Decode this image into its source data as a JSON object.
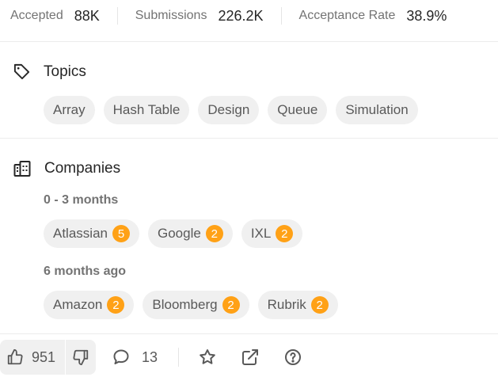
{
  "stats": [
    {
      "label": "Accepted",
      "value": "88K"
    },
    {
      "label": "Submissions",
      "value": "226.2K"
    },
    {
      "label": "Acceptance Rate",
      "value": "38.9%"
    }
  ],
  "topics": {
    "title": "Topics",
    "items": [
      "Array",
      "Hash Table",
      "Design",
      "Queue",
      "Simulation"
    ]
  },
  "companies": {
    "title": "Companies",
    "groups": [
      {
        "period": "0 - 3 months",
        "items": [
          {
            "name": "Atlassian",
            "count": "5"
          },
          {
            "name": "Google",
            "count": "2"
          },
          {
            "name": "IXL",
            "count": "2"
          }
        ]
      },
      {
        "period": "6 months ago",
        "items": [
          {
            "name": "Amazon",
            "count": "2"
          },
          {
            "name": "Bloomberg",
            "count": "2"
          },
          {
            "name": "Rubrik",
            "count": "2"
          }
        ]
      }
    ]
  },
  "actions": {
    "likes": "951",
    "comments": "13"
  },
  "colors": {
    "accent_badge": "#ffa116",
    "chip_bg": "#f0f0f0",
    "muted_text": "#737373"
  }
}
